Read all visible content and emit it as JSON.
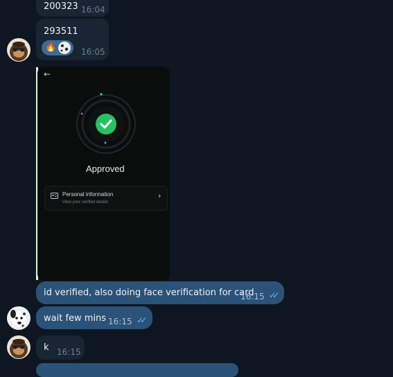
{
  "messages": [
    {
      "text": "200323",
      "time": "16:04"
    },
    {
      "text": "293511",
      "time": "16:05"
    },
    {
      "text": "id verified, also doing face verification for card",
      "time": "16:15"
    },
    {
      "text": "wait few mins",
      "time": "16:15"
    },
    {
      "text": "k",
      "time": "16:15"
    }
  ],
  "reactions": [
    "fire-emoji",
    "dalmatian-avatar"
  ],
  "screenshot": {
    "status": "Approved",
    "card_title": "Personal information",
    "card_subtitle": "View your verified details"
  },
  "colors": {
    "background": "#0e1621",
    "incoming_bubble": "#182533",
    "outgoing_bubble": "#2b5278",
    "approved_green": "#2bc064",
    "read_ticks": "#6fb6f4"
  }
}
